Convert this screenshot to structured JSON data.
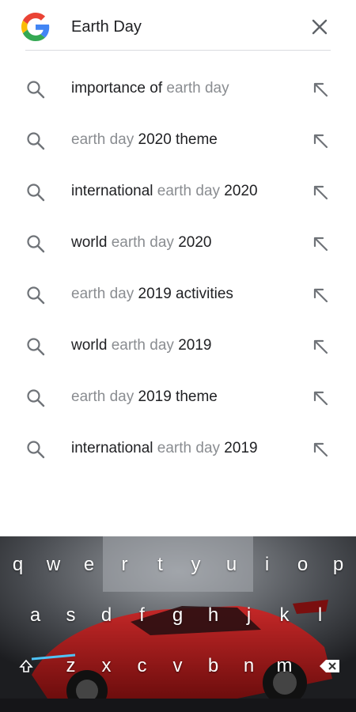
{
  "search": {
    "query": "Earth Day",
    "logo_icon": "google-g-icon",
    "clear_icon": "close-icon"
  },
  "suggestions": [
    {
      "parts": [
        {
          "text": "importance of ",
          "typed": false
        },
        {
          "text": "earth day",
          "typed": true
        }
      ]
    },
    {
      "parts": [
        {
          "text": "earth day",
          "typed": true
        },
        {
          "text": " 2020 theme",
          "typed": false
        }
      ]
    },
    {
      "parts": [
        {
          "text": "international ",
          "typed": false
        },
        {
          "text": "earth day",
          "typed": true
        },
        {
          "text": " 2020",
          "typed": false
        }
      ]
    },
    {
      "parts": [
        {
          "text": "world ",
          "typed": false
        },
        {
          "text": "earth day",
          "typed": true
        },
        {
          "text": " 2020",
          "typed": false
        }
      ]
    },
    {
      "parts": [
        {
          "text": "earth day",
          "typed": true
        },
        {
          "text": " 2019 activities",
          "typed": false
        }
      ]
    },
    {
      "parts": [
        {
          "text": "world ",
          "typed": false
        },
        {
          "text": "earth day",
          "typed": true
        },
        {
          "text": " 2019",
          "typed": false
        }
      ]
    },
    {
      "parts": [
        {
          "text": "earth day",
          "typed": true
        },
        {
          "text": " 2019 theme",
          "typed": false
        }
      ]
    },
    {
      "parts": [
        {
          "text": "international ",
          "typed": false
        },
        {
          "text": "earth day",
          "typed": true
        },
        {
          "text": " 2019",
          "typed": false
        }
      ]
    }
  ],
  "keyboard": {
    "rows": [
      [
        "q",
        "w",
        "e",
        "r",
        "t",
        "y",
        "u",
        "i",
        "o",
        "p"
      ],
      [
        "a",
        "s",
        "d",
        "f",
        "g",
        "h",
        "j",
        "k",
        "l"
      ],
      [
        "z",
        "x",
        "c",
        "v",
        "b",
        "n",
        "m"
      ]
    ],
    "shift_icon": "shift-icon",
    "backspace_icon": "backspace-icon"
  },
  "colors": {
    "typed_text": "#8a8d91",
    "completion_text": "#202124",
    "icon_gray": "#6f7378",
    "divider": "#dadce0"
  }
}
